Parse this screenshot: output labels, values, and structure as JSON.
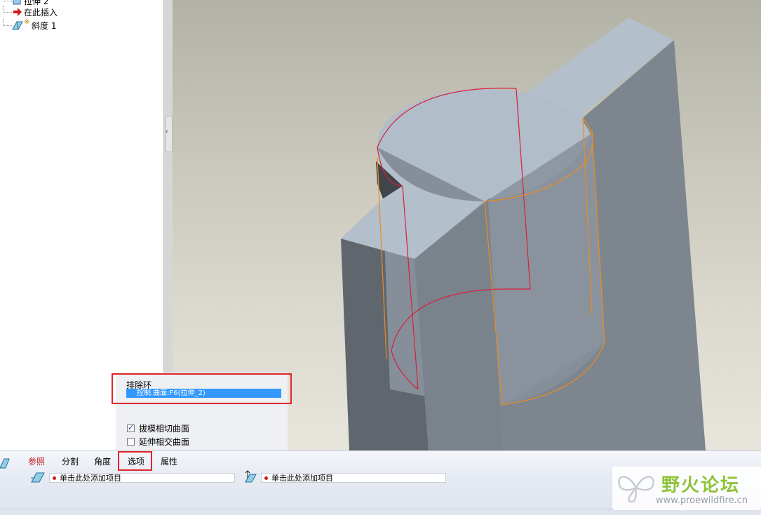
{
  "tree": {
    "rows": [
      {
        "label": "拉伸 2",
        "icon": "extrude-icon"
      },
      {
        "label": "在此插入",
        "icon": "insert-here-arrow-icon"
      },
      {
        "label": "斜度 1",
        "icon": "draft-feature-icon",
        "prefix": "※"
      }
    ]
  },
  "options_panel": {
    "exclusion_title": "排除环",
    "exclusion_item": "控制.曲面:F6(拉伸_2)",
    "checkbox_1": {
      "label": "拔模相切曲面",
      "checked": true
    },
    "checkbox_2": {
      "label": "延伸相交曲面",
      "checked": false
    }
  },
  "dashboard": {
    "tabs": [
      {
        "label": "参照"
      },
      {
        "label": "分割"
      },
      {
        "label": "角度"
      },
      {
        "label": "选项"
      },
      {
        "label": "属性"
      }
    ],
    "field_1": "单击此处添加项目",
    "field_2": "单击此处添加项目"
  },
  "watermark": {
    "cn": "野火论坛",
    "url": "www.proewildfire.cn"
  },
  "colors": {
    "highlight_box": "#e0262a",
    "selection": "#3399ff",
    "model_top": "#b2bec8",
    "model_side": "#7e8791",
    "edge_red": "#d81f3c",
    "edge_orange": "#f08a1c"
  }
}
